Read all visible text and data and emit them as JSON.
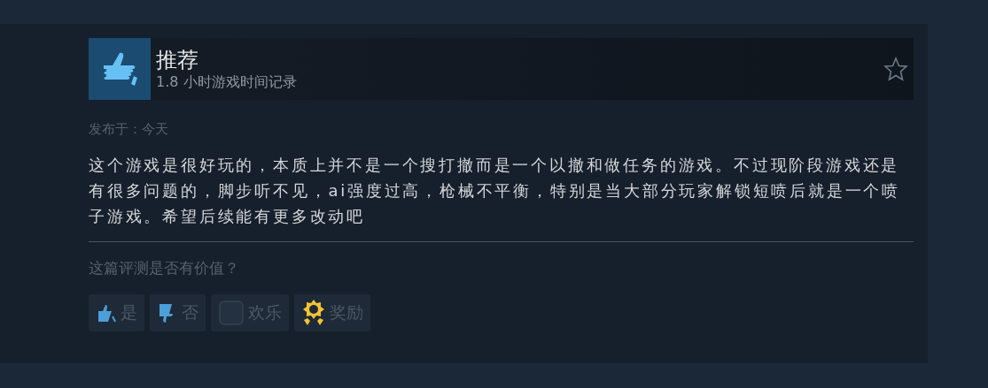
{
  "review": {
    "verdict": "推荐",
    "playtime": "1.8 小时游戏时间记录",
    "posted": "发布于：今天",
    "body": "这个游戏是很好玩的，本质上并不是一个搜打撤而是一个以撤和做任务的游戏。不过现阶段游戏还是有很多问题的，脚步听不见，ai强度过高，枪械不平衡，特别是当大部分玩家解锁短喷后就是一个喷子游戏。希望后续能有更多改动吧"
  },
  "feedback": {
    "question": "这篇评测是否有价值？",
    "buttons": [
      {
        "kind": "yes",
        "label": "是"
      },
      {
        "kind": "no",
        "label": "否"
      },
      {
        "kind": "funny",
        "label": "欢乐"
      },
      {
        "kind": "award",
        "label": "奖励"
      }
    ]
  }
}
